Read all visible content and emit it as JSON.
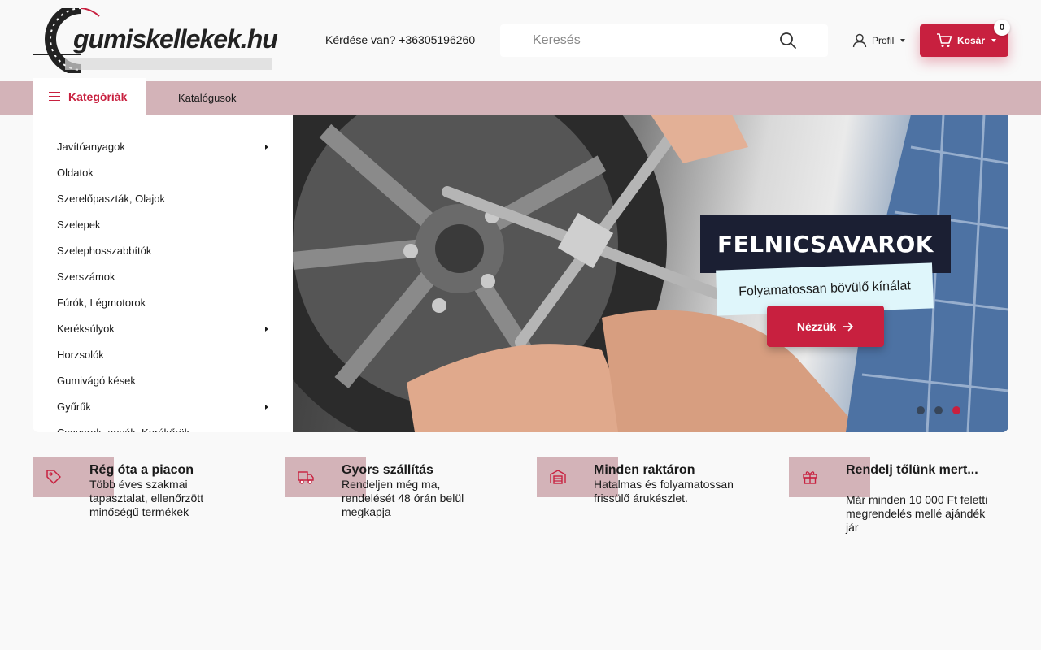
{
  "header": {
    "logo_text": "gumiskellekek.hu",
    "phone_text": "Kérdése van? +36305196260",
    "search_placeholder": "Keresés",
    "profile_label": "Profil",
    "cart_label": "Kosár",
    "cart_count": "0"
  },
  "nav": {
    "categories_label": "Kategóriák",
    "catalogs_label": "Katalógusok"
  },
  "categories": [
    {
      "label": "Javítóanyagok",
      "has_submenu": true
    },
    {
      "label": "Oldatok",
      "has_submenu": false
    },
    {
      "label": "Szerelőpaszták, Olajok",
      "has_submenu": false
    },
    {
      "label": "Szelepek",
      "has_submenu": false
    },
    {
      "label": "Szelephosszabbítók",
      "has_submenu": false
    },
    {
      "label": "Szerszámok",
      "has_submenu": false
    },
    {
      "label": "Fúrók, Légmotorok",
      "has_submenu": false
    },
    {
      "label": "Keréksúlyok",
      "has_submenu": true
    },
    {
      "label": "Horzsolók",
      "has_submenu": false
    },
    {
      "label": "Gumivágó kések",
      "has_submenu": false
    },
    {
      "label": "Gyűrűk",
      "has_submenu": true
    },
    {
      "label": "Csavarok, anyák, Kerékőrök",
      "has_submenu": false
    }
  ],
  "hero": {
    "title": "FELNICSAVAROK",
    "subtitle": "Folyamatossan bövülő kínálat",
    "button_label": "Nézzük",
    "slide_count": 3,
    "active_slide": 3
  },
  "features": [
    {
      "icon": "tag-icon",
      "title": "Rég óta a piacon",
      "desc": "Több éves szakmai tapasztalat, ellenőrzött minőségű termékek"
    },
    {
      "icon": "truck-icon",
      "title": "Gyors szállítás",
      "desc": "Rendeljen még ma, rendelését 48 órán belül megkapja"
    },
    {
      "icon": "warehouse-icon",
      "title": "Minden raktáron",
      "desc": "Hatalmas és folyamatossan frissülő árukészlet."
    },
    {
      "icon": "gift-icon",
      "title": "Rendelj tőlünk mert...",
      "desc": "Már minden 10 000 Ft feletti megrendelés mellé ajándék jár"
    }
  ],
  "colors": {
    "brand_red": "#c8203f",
    "nav_pink": "#d3b3b8",
    "hero_title_bg": "#1b1f33",
    "hero_sub_bg": "#dff6fb"
  }
}
